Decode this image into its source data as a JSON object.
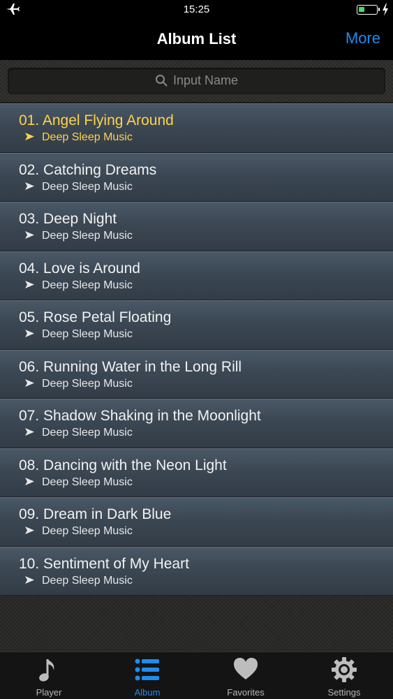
{
  "status_bar": {
    "time": "15:25"
  },
  "nav": {
    "title": "Album List",
    "more_label": "More"
  },
  "search": {
    "placeholder": "Input Name"
  },
  "albums": [
    {
      "title": "01. Angel Flying Around",
      "artist": "Deep Sleep Music",
      "active": true
    },
    {
      "title": "02. Catching Dreams",
      "artist": "Deep Sleep Music"
    },
    {
      "title": "03. Deep Night",
      "artist": "Deep Sleep Music"
    },
    {
      "title": "04. Love is Around",
      "artist": "Deep Sleep Music"
    },
    {
      "title": "05. Rose Petal Floating",
      "artist": "Deep Sleep Music"
    },
    {
      "title": "06. Running Water in the Long Rill",
      "artist": "Deep Sleep Music"
    },
    {
      "title": "07. Shadow Shaking in the Moonlight",
      "artist": "Deep Sleep Music"
    },
    {
      "title": "08. Dancing with the Neon Light",
      "artist": "Deep Sleep Music"
    },
    {
      "title": "09. Dream in Dark Blue",
      "artist": "Deep Sleep Music"
    },
    {
      "title": "10. Sentiment of My Heart",
      "artist": "Deep Sleep Music"
    }
  ],
  "tabs": [
    {
      "label": "Player",
      "icon": "music-note-icon"
    },
    {
      "label": "Album",
      "icon": "list-icon",
      "active": true
    },
    {
      "label": "Favorites",
      "icon": "heart-icon"
    },
    {
      "label": "Settings",
      "icon": "gear-icon"
    }
  ],
  "colors": {
    "accent": "#1e8cf0",
    "active_row": "#ffd24a",
    "battery": "#4cd964"
  }
}
